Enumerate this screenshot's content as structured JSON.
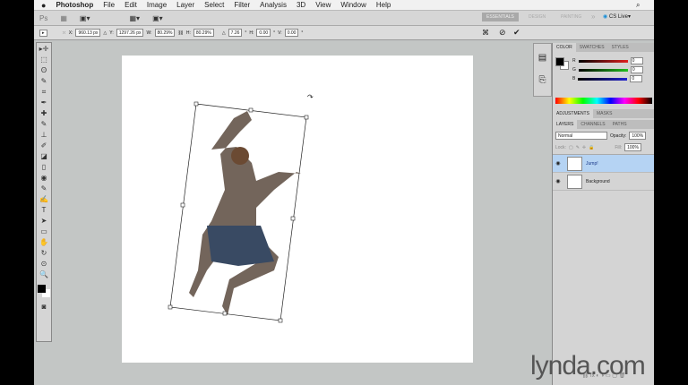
{
  "menu": {
    "apple": "",
    "items": [
      "Photoshop",
      "File",
      "Edit",
      "Image",
      "Layer",
      "Select",
      "Filter",
      "Analysis",
      "3D",
      "View",
      "Window",
      "Help"
    ]
  },
  "appbar": {
    "logo": "Ps",
    "workspaces": [
      "ESSENTIALS",
      "DESIGN",
      "PAINTING"
    ],
    "more": "»",
    "cslive": "CS Live"
  },
  "options": {
    "x_label": "X:",
    "x": "960.13 px",
    "y_label": "Y:",
    "y": "1297.26 px",
    "w_label": "W:",
    "w": "80.29%",
    "h_label": "H:",
    "h": "80.29%",
    "angle_label": "△",
    "angle": "7.26",
    "skew_h_label": "H:",
    "skew_h": "0.00",
    "skew_v_label": "V:",
    "skew_v": "0.00"
  },
  "tools": [
    "▸✛",
    "⬚",
    "ʘ",
    "✎",
    "⌗",
    "✒",
    "✚",
    "✎",
    "⊥",
    "✐",
    "◪",
    "▯",
    "◉",
    "✎",
    "✍",
    "T",
    "➤",
    "▭",
    "✋",
    "↻",
    "⊙",
    "🔍"
  ],
  "color_panel": {
    "tabs": [
      "COLOR",
      "SWATCHES",
      "STYLES"
    ],
    "r_label": "R",
    "r": "0",
    "g_label": "G",
    "g": "0",
    "b_label": "B",
    "b": "0"
  },
  "adjust_panel": {
    "tabs": [
      "ADJUSTMENTS",
      "MASKS"
    ]
  },
  "layers_panel": {
    "tabs": [
      "LAYERS",
      "CHANNELS",
      "PATHS"
    ],
    "blend": "Normal",
    "opacity_label": "Opacity:",
    "opacity": "100%",
    "lock_label": "Lock:",
    "fill_label": "Fill:",
    "fill": "100%",
    "layers": [
      {
        "name": "Jump!",
        "selected": true
      },
      {
        "name": "Background",
        "selected": false
      }
    ]
  },
  "watermark": "lynda.com"
}
